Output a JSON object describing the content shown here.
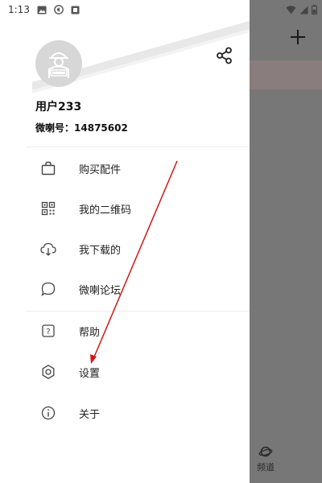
{
  "status_bar": {
    "time": "1:13"
  },
  "profile": {
    "username": "用户233",
    "weila_id_label": "微喇号：",
    "weila_id": "14875602"
  },
  "menu": {
    "group1": [
      {
        "label": "购买配件",
        "icon": "shopping-bag-icon"
      },
      {
        "label": "我的二维码",
        "icon": "qr-code-icon"
      },
      {
        "label": "我下载的",
        "icon": "cloud-download-icon"
      },
      {
        "label": "微喇论坛",
        "icon": "chat-bubble-icon"
      }
    ],
    "group2": [
      {
        "label": "帮助",
        "icon": "help-icon"
      },
      {
        "label": "设置",
        "icon": "settings-icon"
      },
      {
        "label": "关于",
        "icon": "info-icon"
      }
    ]
  },
  "background_app": {
    "bottom_tab_label": "频道"
  },
  "annotation": {
    "color": "#d01818"
  }
}
